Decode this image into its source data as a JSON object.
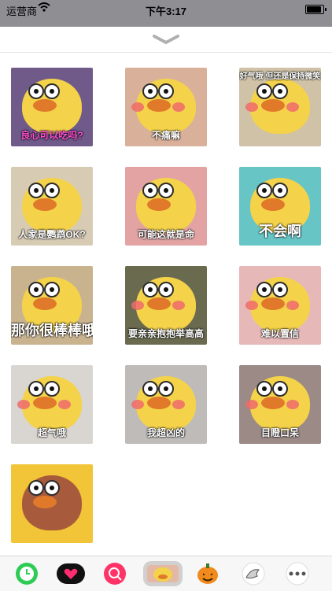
{
  "status_bar": {
    "carrier": "运营商",
    "time": "下午3:17"
  },
  "sheet": {
    "handle_icon": "chevron-down-icon"
  },
  "stickers": [
    {
      "caption": "良心可以吃吗?",
      "bg": "#6f5a8a"
    },
    {
      "caption": "不痛嘛",
      "bg": "#d9b19a"
    },
    {
      "caption": "好气哦 但还是保持微笑",
      "bg": "#cfc2a6"
    },
    {
      "caption": "人家是鹦鹉OK?",
      "bg": "#d7cbb4"
    },
    {
      "caption": "可能这就是命",
      "bg": "#e4a3a3"
    },
    {
      "caption": "不会啊",
      "bg": "#67c5c6"
    },
    {
      "caption": "那你很棒棒哦",
      "bg": "#c9b38f"
    },
    {
      "caption": "要亲亲抱抱举高高",
      "bg": "#6a6a4f"
    },
    {
      "caption": "难以置信",
      "bg": "#e7b8b8"
    },
    {
      "caption": "超气哦",
      "bg": "#d9d5d0"
    },
    {
      "caption": "我超凶的",
      "bg": "#bfbbb8"
    },
    {
      "caption": "目瞪口呆",
      "bg": "#9b8a86"
    },
    {
      "caption": "",
      "bg": "#f2c437"
    }
  ],
  "app_bar": {
    "apps": [
      {
        "name": "clock-app-icon"
      },
      {
        "name": "heart-app-icon"
      },
      {
        "name": "search-app-icon"
      },
      {
        "name": "duck-sticker-app-icon"
      },
      {
        "name": "pumpkin-app-icon"
      },
      {
        "name": "bird-app-icon"
      },
      {
        "name": "more-icon"
      }
    ]
  }
}
